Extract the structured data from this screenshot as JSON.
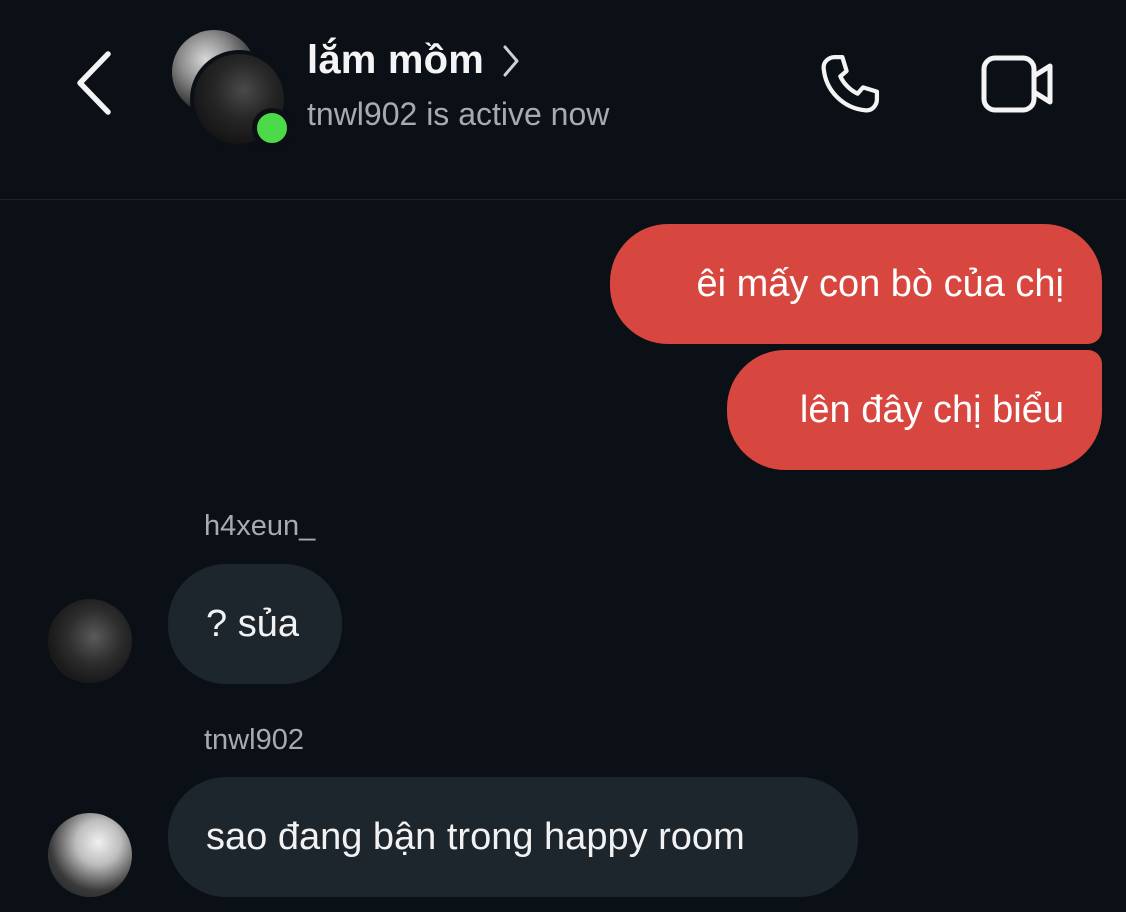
{
  "header": {
    "title": "lắm mồm",
    "status": "tnwl902 is active now",
    "online_color": "#4cd94a",
    "icons": {
      "back": "chevron-left-icon",
      "title_chevron": "chevron-right-icon",
      "call": "phone-icon",
      "video": "video-camera-icon"
    }
  },
  "messages": [
    {
      "type": "sent",
      "text": "êi mấy con bò của chị"
    },
    {
      "type": "sent",
      "text": "lên đây chị biểu"
    },
    {
      "type": "received",
      "sender": "h4xeun_",
      "text": "? sủa"
    },
    {
      "type": "received",
      "sender": "tnwl902",
      "text": "sao đang bận trong happy room"
    }
  ],
  "colors": {
    "background": "#0b1016",
    "sent_bubble": "#d7473f",
    "received_bubble": "#1d252d",
    "secondary_text": "#a6abb2"
  }
}
